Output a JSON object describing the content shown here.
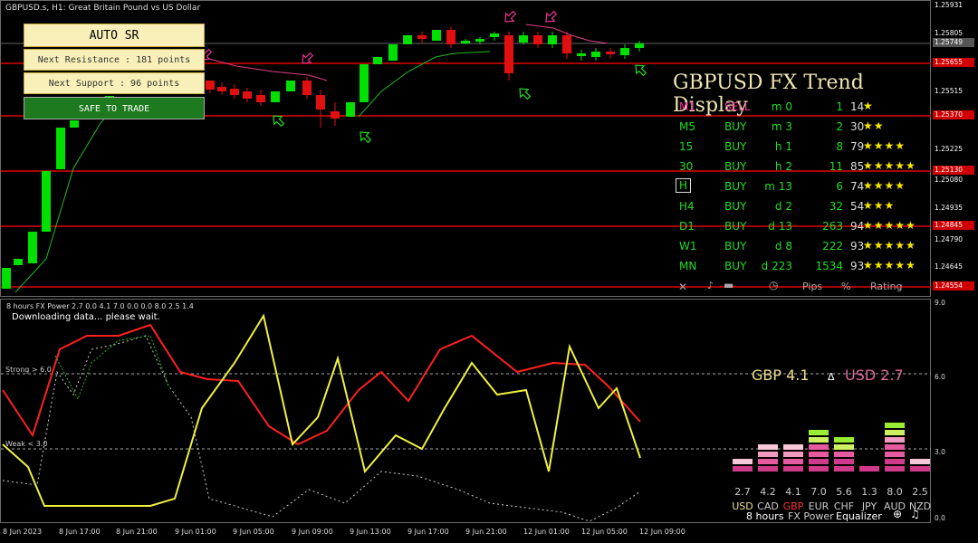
{
  "chart": {
    "symbol": "GBPUSD.s, H1:  Great Britain Pound vs US Dollar",
    "price_labels": [
      "1.25931",
      "1.25805",
      "1.25749",
      "1.25655",
      "1.25515",
      "1.25370",
      "1.25225",
      "1.25130",
      "1.25080",
      "1.24935",
      "1.24845",
      "1.24790",
      "1.24645",
      "1.24554"
    ],
    "highlight_prices": {
      "current": "1.25749",
      "r1": "1.25655",
      "r2": "1.25370",
      "r3": "1.25130",
      "r4": "1.24845",
      "r5": "1.24554"
    }
  },
  "auto_sr": {
    "title": "AUTO  SR",
    "next_resistance": "Next Resistance : 181 points",
    "next_support": "Next Support : 96 points",
    "status": "SAFE TO TRADE"
  },
  "trend_display": {
    "title": "GBPUSD FX Trend Display",
    "rows": [
      {
        "tf": "M1",
        "signal": "SELL",
        "time": "0 m",
        "pips": "1",
        "pct": "14",
        "stars": "★"
      },
      {
        "tf": "M5",
        "signal": "BUY",
        "time": "3 m",
        "pips": "2",
        "pct": "30",
        "stars": "★★"
      },
      {
        "tf": "15",
        "signal": "BUY",
        "time": "1 h",
        "pips": "8",
        "pct": "79",
        "stars": "★★★★"
      },
      {
        "tf": "30",
        "signal": "BUY",
        "time": "2 h",
        "pips": "11",
        "pct": "85",
        "stars": "★★★★★"
      },
      {
        "tf": "H",
        "signal": "BUY",
        "time": "13 m",
        "pips": "6",
        "pct": "74",
        "stars": "★★★★"
      },
      {
        "tf": "H4",
        "signal": "BUY",
        "time": "2 d",
        "pips": "32",
        "pct": "54",
        "stars": "★★★"
      },
      {
        "tf": "D1",
        "signal": "BUY",
        "time": "13 d",
        "pips": "263",
        "pct": "94",
        "stars": "★★★★★"
      },
      {
        "tf": "W1",
        "signal": "BUY",
        "time": "8 d",
        "pips": "222",
        "pct": "93",
        "stars": "★★★★★"
      },
      {
        "tf": "MN",
        "signal": "BUY",
        "time": "223 d",
        "pips": "1534",
        "pct": "93",
        "stars": "★★★★★"
      }
    ],
    "footer": {
      "pips": "Pips",
      "pct": "%",
      "rating": "Rating"
    }
  },
  "power": {
    "header": "8 hours FX Power 2.7 0.0 4.1 7.0 0.0 0.0 8.0 2.5 1.4",
    "status": "Downloading data... please wait.",
    "strong_label": "Strong > 6.0",
    "weak_label": "Weak < 3.0",
    "y_labels": [
      "9.0",
      "6.0",
      "3.0",
      "0.0"
    ],
    "gbp_label": "GBP 4.1",
    "usd_label": "USD 2.7",
    "delta": "Δ",
    "footer_period": "8 hours",
    "footer_name": "FX Power",
    "footer_eq": "Equalizer"
  },
  "equalizer": {
    "currencies": [
      "USD",
      "CAD",
      "GBP",
      "EUR",
      "CHF",
      "JPY",
      "AUD",
      "NZD"
    ],
    "values": [
      "2.7",
      "4.2",
      "4.1",
      "7.0",
      "5.6",
      "1.3",
      "8.0",
      "2.5"
    ],
    "levels": [
      2.7,
      4.2,
      4.1,
      7.0,
      5.6,
      1.3,
      8.0,
      2.5
    ]
  },
  "time_labels": [
    "8 Jun 2023",
    "8 Jun 17:00",
    "8 Jun 21:00",
    "9 Jun 01:00",
    "9 Jun 05:00",
    "9 Jun 09:00",
    "9 Jun 13:00",
    "9 Jun 17:00",
    "9 Jun 21:00",
    "12 Jun 01:00",
    "12 Jun 05:00",
    "12 Jun 09:00"
  ],
  "colors": {
    "bull": "#00e000",
    "bear": "#e01010",
    "resistance": "#e00000",
    "gbp": "#f0e08a",
    "usd": "#e06aa0",
    "eq_green": "#99ee33",
    "eq_pink": "#d03a8a"
  }
}
